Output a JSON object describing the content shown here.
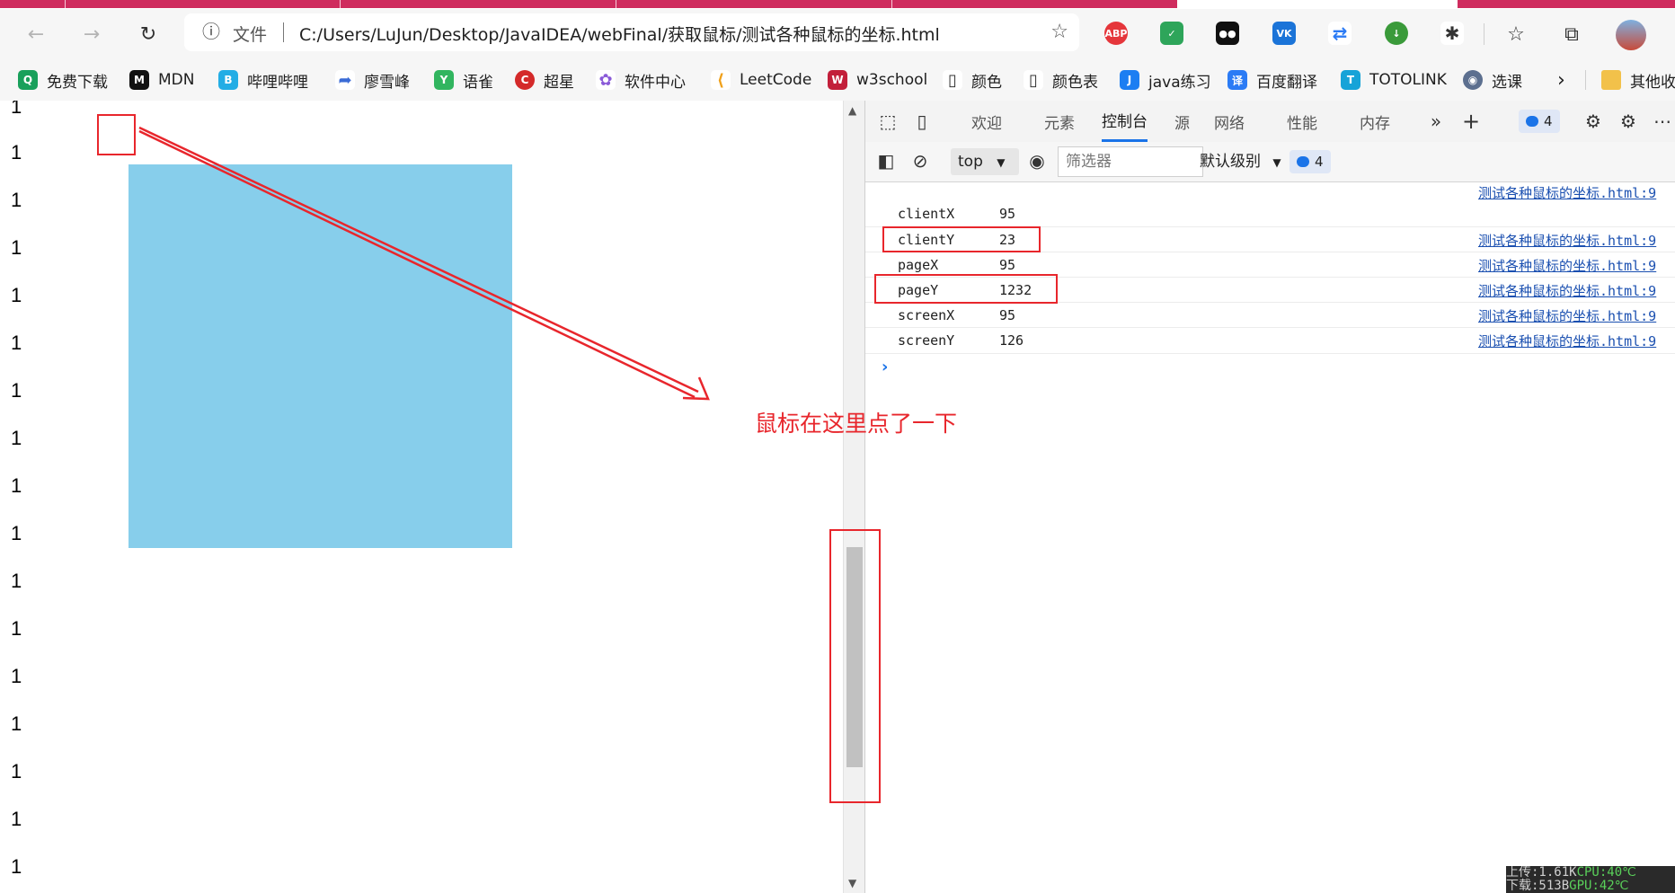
{
  "browser": {
    "address": {
      "info_label": "文件",
      "url": "C:/Users/LuJun/Desktop/JavaIDEA/webFinal/获取鼠标/测试各种鼠标的坐标.html"
    },
    "extensions": [
      "ABP",
      "shield",
      "tampermonkey",
      "vk",
      "repeat",
      "idm",
      "puzzle"
    ],
    "toolbar_icons": [
      "back-icon",
      "forward-icon",
      "refresh-icon",
      "favorites-icon",
      "collections-icon",
      "profile-avatar"
    ]
  },
  "bookmarks": [
    {
      "label": "免费下载",
      "icon": "Q",
      "color": "#19a05b"
    },
    {
      "label": "MDN",
      "icon": "M",
      "color": "#111111"
    },
    {
      "label": "哔哩哔哩",
      "icon": "B",
      "color": "#23ade5"
    },
    {
      "label": "廖雪峰",
      "icon": "➶",
      "color": "#3a6bd6"
    },
    {
      "label": "语雀",
      "icon": "Y",
      "color": "#31b55f"
    },
    {
      "label": "超星",
      "icon": "C",
      "color": "#d42a2a"
    },
    {
      "label": "软件中心",
      "icon": "✿",
      "color": "#8a5ad8"
    },
    {
      "label": "LeetCode",
      "icon": "L",
      "color": "#f0a01a"
    },
    {
      "label": "w3school",
      "icon": "W",
      "color": "#c21f3a"
    },
    {
      "label": "颜色",
      "icon": "▯",
      "color": "#ffffff"
    },
    {
      "label": "颜色表",
      "icon": "▯",
      "color": "#ffffff"
    },
    {
      "label": "java练习",
      "icon": "J",
      "color": "#1c7ef2"
    },
    {
      "label": "百度翻译",
      "icon": "译",
      "color": "#2b7bf5"
    },
    {
      "label": "TOTOLINK",
      "icon": "T",
      "color": "#16a3d8"
    },
    {
      "label": "选课",
      "icon": "◉",
      "color": "#5c6f8f"
    }
  ],
  "bookmarks_more": "其他收",
  "page": {
    "line_text": "1",
    "annotation": "鼠标在这里点了一下"
  },
  "devtools": {
    "tabs": [
      "欢迎",
      "元素",
      "控制台",
      "源",
      "网络",
      "性能",
      "内存"
    ],
    "active_tab": "控制台",
    "issues_count": "4",
    "context": "top",
    "filter_placeholder": "筛选器",
    "level": "默认级别",
    "log_count": "4",
    "source_link": "测试各种鼠标的坐标.html:9",
    "logs": [
      {
        "key": "clientX",
        "value": "95"
      },
      {
        "key": "clientY",
        "value": "23"
      },
      {
        "key": "pageX",
        "value": "95"
      },
      {
        "key": "pageY",
        "value": "1232"
      },
      {
        "key": "screenX",
        "value": "95"
      },
      {
        "key": "screenY",
        "value": "126"
      }
    ],
    "prompt": "›"
  },
  "perf_overlay": {
    "line1_label": "上传:1.61K",
    "line1_cpu": "CPU:40℃",
    "line2_label": "下载:513B",
    "line2_cpu": "GPU:42℃"
  },
  "colors": {
    "accent": "#1a73e8",
    "annotation_red": "#e8262c",
    "box_blue": "#87ceeb",
    "tab_strip": "#cf2c5e"
  }
}
